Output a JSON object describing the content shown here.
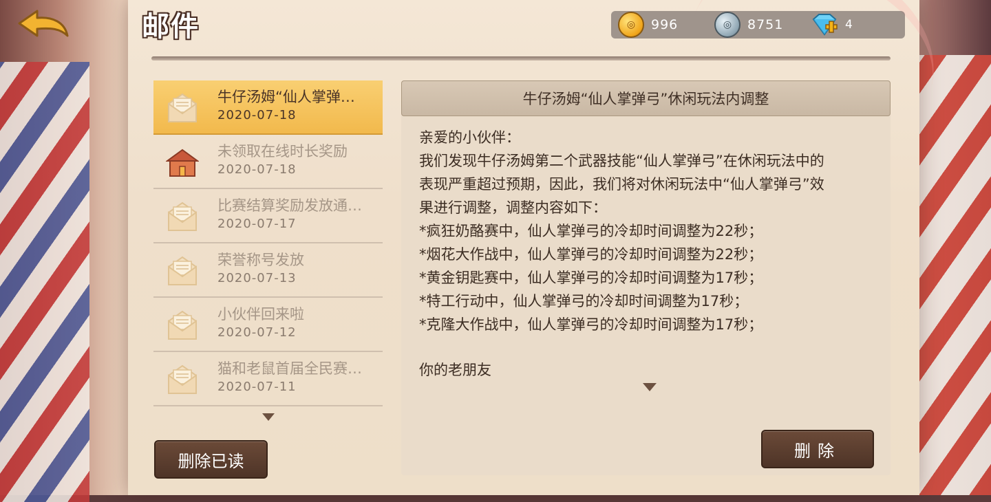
{
  "header": {
    "title": "邮件",
    "currencies": {
      "gold": "996",
      "silver": "8751",
      "diamond": "4"
    }
  },
  "mails": [
    {
      "subject": "牛仔汤姆“仙人掌弹…",
      "date": "2020-07-18",
      "icon": "envelope-open-icon",
      "selected": true
    },
    {
      "subject": "未领取在线时长奖励",
      "date": "2020-07-18",
      "icon": "house-icon",
      "selected": false
    },
    {
      "subject": "比赛结算奖励发放通…",
      "date": "2020-07-17",
      "icon": "envelope-open-icon",
      "selected": false
    },
    {
      "subject": "荣誉称号发放",
      "date": "2020-07-13",
      "icon": "envelope-open-icon",
      "selected": false
    },
    {
      "subject": "小伙伴回来啦",
      "date": "2020-07-12",
      "icon": "envelope-open-icon",
      "selected": false
    },
    {
      "subject": "猫和老鼠首届全民赛…",
      "date": "2020-07-11",
      "icon": "envelope-open-icon",
      "selected": false
    }
  ],
  "buttons": {
    "delete_read": "删除已读",
    "delete": "删除"
  },
  "content": {
    "title": "牛仔汤姆“仙人掌弹弓”休闲玩法内调整",
    "lines": [
      "亲爱的小伙伴：",
      "我们发现牛仔汤姆第二个武器技能“仙人掌弹弓”在休闲玩法中的",
      "表现严重超过预期，因此，我们将对休闲玩法中“仙人掌弹弓”效",
      "果进行调整，调整内容如下：",
      "*疯狂奶酪赛中，仙人掌弹弓的冷却时间调整为22秒；",
      "*烟花大作战中，仙人掌弹弓的冷却时间调整为22秒；",
      "*黄金钥匙赛中，仙人掌弹弓的冷却时间调整为17秒；",
      "*特工行动中，仙人掌弹弓的冷却时间调整为17秒；",
      "*克隆大作战中，仙人掌弹弓的冷却时间调整为17秒；"
    ],
    "signature": "你的老朋友"
  },
  "colors": {
    "selected_bg": "#f5c35c",
    "button_bg": "#5a3d2e",
    "text_dark": "#3c2d23"
  }
}
